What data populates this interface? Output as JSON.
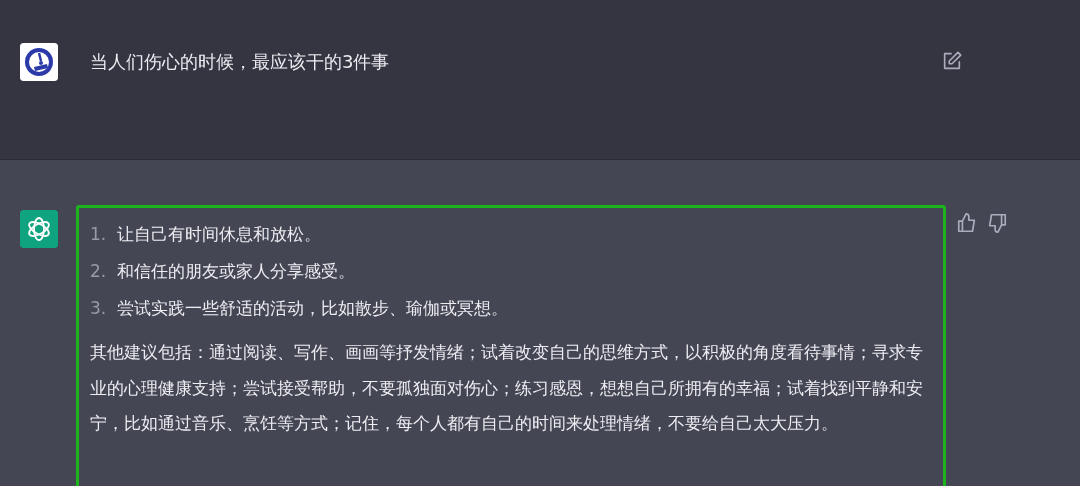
{
  "prompt": {
    "text": "当人们伤心的时候，最应该干的3件事"
  },
  "answer": {
    "list": [
      {
        "number": "1.",
        "text": "让自己有时间休息和放松。"
      },
      {
        "number": "2.",
        "text": "和信任的朋友或家人分享感受。"
      },
      {
        "number": "3.",
        "text": "尝试实践一些舒适的活动，比如散步、瑜伽或冥想。"
      }
    ],
    "paragraph": "其他建议包括：通过阅读、写作、画画等抒发情绪；试着改变自己的思维方式，以积极的角度看待事情；寻求专业的心理健康支持；尝试接受帮助，不要孤独面对伤心；练习感恩，想想自己所拥有的幸福；试着找到平静和安宁，比如通过音乐、烹饪等方式；记住，每个人都有自己的时间来处理情绪，不要给自己太大压力。"
  }
}
